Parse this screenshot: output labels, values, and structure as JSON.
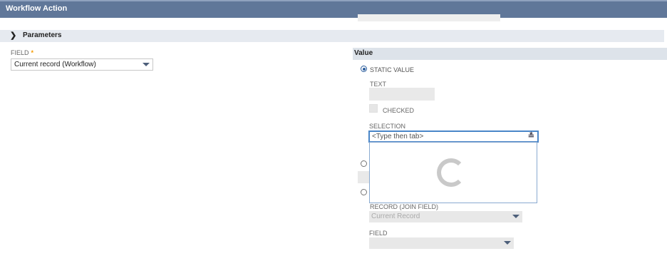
{
  "window": {
    "title": "Workflow Action"
  },
  "section": {
    "label": "Parameters"
  },
  "field": {
    "label": "FIELD",
    "required_mark": "*",
    "value": "Current record  (Workflow)"
  },
  "value_panel": {
    "header": "Value",
    "static_value_label": "STATIC VALUE",
    "text_label": "TEXT",
    "checked_label": "CHECKED",
    "selection_label": "SELECTION",
    "selection_placeholder": "<Type then tab>",
    "record_join_label": "RECORD (JOIN FIELD)",
    "record_join_value": "Current Record",
    "field2_label": "FIELD"
  },
  "icons": {
    "section_toggle": "chevron-down-icon",
    "dropdown_arrow": "caret-down-icon",
    "combo_arrow": "double-chevron-down-icon",
    "loading": "loading-spinner-icon"
  },
  "colors": {
    "titlebar": "#607799",
    "section": "#e6eaf0",
    "focus": "#4a86c8",
    "required": "#f59b00"
  }
}
